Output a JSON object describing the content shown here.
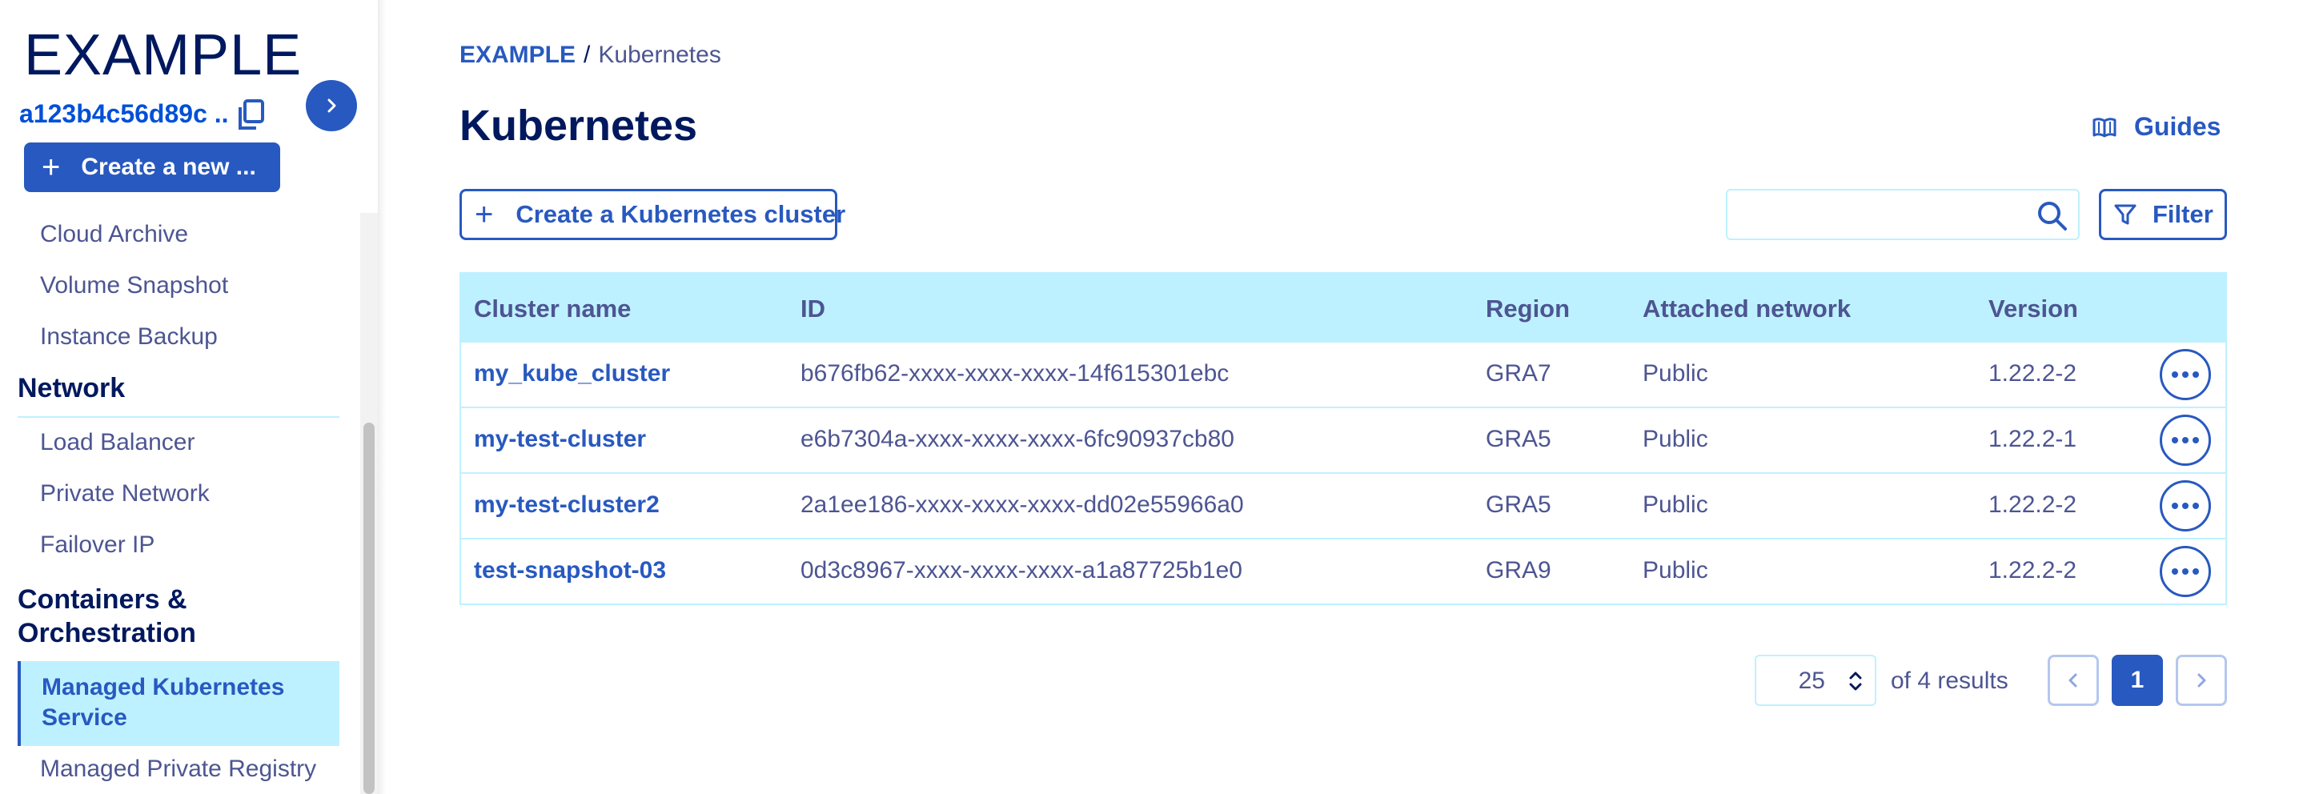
{
  "sidebar": {
    "brand": "EXAMPLE",
    "project_id": "a123b4c56d89c ...",
    "create_new_label": "Create a new ...",
    "items": [
      {
        "label": "Cloud Archive"
      },
      {
        "label": "Volume Snapshot"
      },
      {
        "label": "Instance Backup"
      }
    ],
    "sections": {
      "network": {
        "title": "Network",
        "items": [
          {
            "label": "Load Balancer"
          },
          {
            "label": "Private Network"
          },
          {
            "label": "Failover IP"
          }
        ]
      },
      "containers": {
        "title_line1": "Containers &",
        "title_line2": "Orchestration",
        "active_line1": "Managed Kubernetes",
        "active_line2": "Service",
        "next_item": "Managed Private Registry"
      }
    }
  },
  "breadcrumb": {
    "root": "EXAMPLE",
    "separator": "/",
    "current": "Kubernetes"
  },
  "page": {
    "title": "Kubernetes",
    "guides_label": "Guides",
    "create_cluster_label": "Create a Kubernetes cluster",
    "search_value": "",
    "filter_label": "Filter"
  },
  "table": {
    "columns": [
      "Cluster name",
      "ID",
      "Region",
      "Attached network",
      "Version"
    ],
    "rows": [
      {
        "name": "my_kube_cluster",
        "id": "b676fb62-xxxx-xxxx-xxxx-14f615301ebc",
        "region": "GRA7",
        "network": "Public",
        "version": "1.22.2-2"
      },
      {
        "name": "my-test-cluster",
        "id": "e6b7304a-xxxx-xxxx-xxxx-6fc90937cb80",
        "region": "GRA5",
        "network": "Public",
        "version": "1.22.2-1"
      },
      {
        "name": "my-test-cluster2",
        "id": "2a1ee186-xxxx-xxxx-xxxx-dd02e55966a0",
        "region": "GRA5",
        "network": "Public",
        "version": "1.22.2-2"
      },
      {
        "name": "test-snapshot-03",
        "id": "0d3c8967-xxxx-xxxx-xxxx-a1a87725b1e0",
        "region": "GRA9",
        "network": "Public",
        "version": "1.22.2-2"
      }
    ]
  },
  "pagination": {
    "page_size": "25",
    "results_text": "of 4 results",
    "current_page": "1"
  },
  "colors": {
    "primary": "#2859c0",
    "navy": "#00185e",
    "light_blue": "#bef1ff",
    "text_muted": "#4d5592"
  },
  "icons": [
    "copy-icon",
    "chevron-right-icon",
    "plus-icon",
    "book-icon",
    "search-icon",
    "filter-icon",
    "more-icon",
    "chevron-left-icon",
    "sort-arrows-icon"
  ]
}
